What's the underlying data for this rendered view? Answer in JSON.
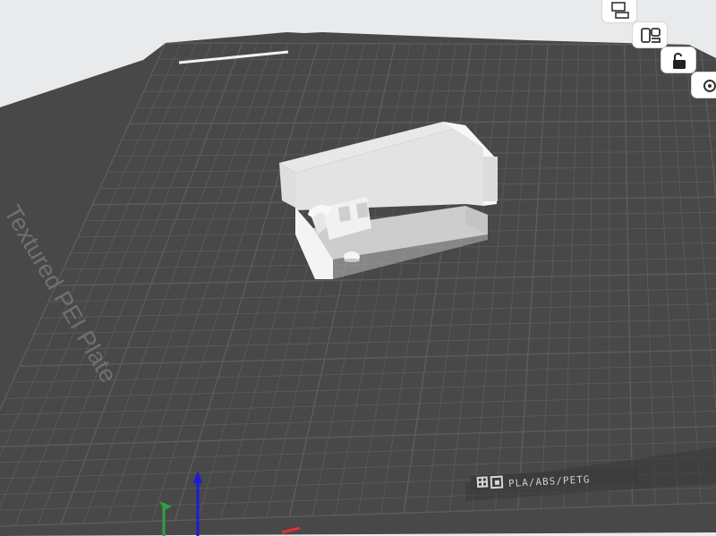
{
  "viewport": {
    "plate_label": "Textured PEI Plate",
    "compat_label": "PLA/ABS/PETG",
    "colors": {
      "background": "#e9eaec",
      "plate": "#484848",
      "grid_line": "#5c5c5c",
      "model": "#ececec",
      "axis_x": "#e03131",
      "axis_y": "#2f9e44",
      "axis_z": "#1c1cd8"
    }
  },
  "toolbar": {
    "tools": [
      {
        "name": "arrange",
        "icon": "arrange-icon"
      },
      {
        "name": "orient",
        "icon": "orient-icon"
      },
      {
        "name": "lock",
        "icon": "lock-icon"
      },
      {
        "name": "settings",
        "icon": "gear-icon"
      }
    ]
  }
}
